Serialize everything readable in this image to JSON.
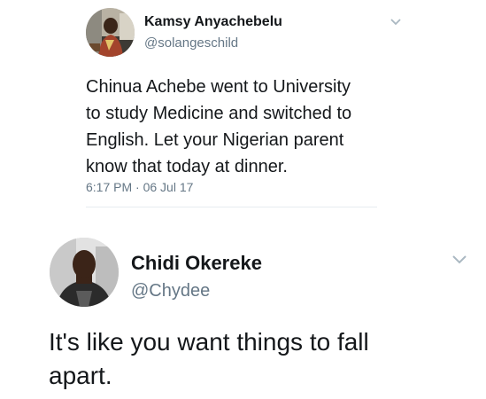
{
  "quoted_tweet": {
    "author_name": "Kamsy Anyachebelu",
    "author_handle": "@solangeschild",
    "text_lines": [
      "Chinua Achebe went to University",
      "to study Medicine and switched to",
      "English. Let your Nigerian parent",
      "know that today at dinner."
    ],
    "timestamp": "6:17 PM · 06 Jul 17",
    "menu_icon": "chevron-down-icon"
  },
  "reply_tweet": {
    "author_name": "Chidi Okereke",
    "author_handle": "@Chydee",
    "text_lines": [
      "It's like you want things to fall",
      "apart."
    ],
    "menu_icon": "chevron-down-icon"
  },
  "colors": {
    "text_primary": "#14171a",
    "text_secondary": "#657786",
    "divider": "#e6ecf0",
    "chevron": "#aab8c2"
  }
}
